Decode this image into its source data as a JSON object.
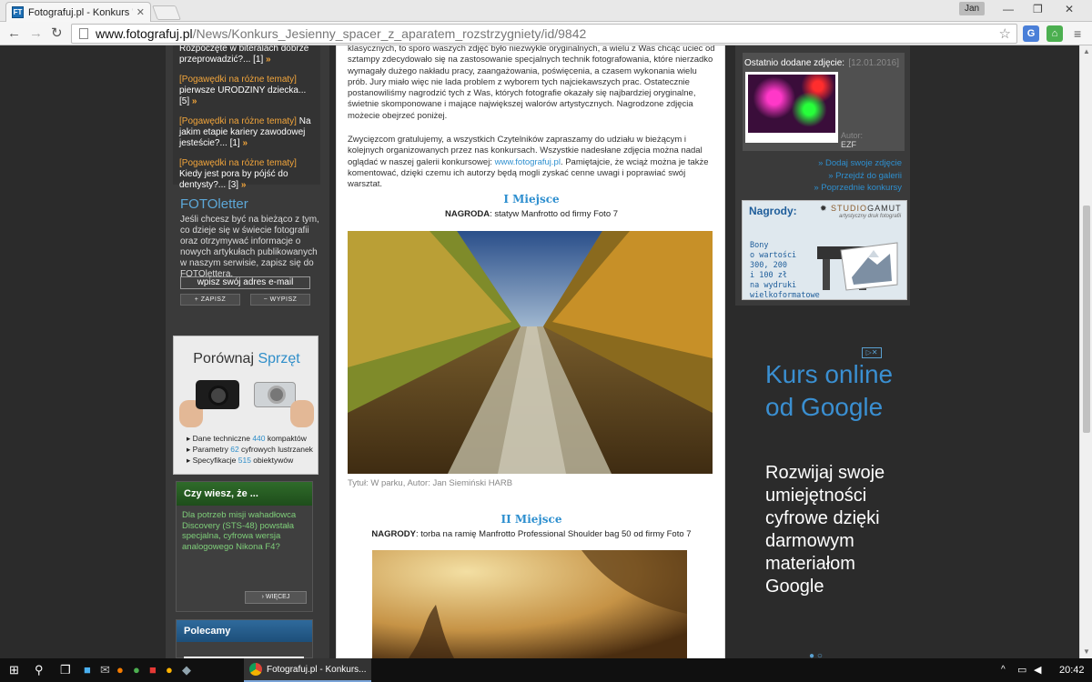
{
  "browser": {
    "tab_title": "Fotografuj.pl - Konkurs \"Je",
    "user": "Jan",
    "url_host": "www.fotografuj.pl",
    "url_path": "/News/Konkurs_Jesienny_spacer_z_aparatem_rozstrzygniety/id/9842"
  },
  "left": {
    "forum": [
      {
        "cat": "",
        "text": "Rozpoczęte w biteralach dobrze przeprowadzić?... [1]",
        "more": "»"
      },
      {
        "cat": "[Pogawędki na różne tematy]",
        "text": "pierwsze URODZINY dziecka... [5]",
        "more": "»"
      },
      {
        "cat": "[Pogawędki na różne tematy]",
        "text": "Na jakim etapie kariery zawodowej jesteście?... [1]",
        "more": "»"
      },
      {
        "cat": "[Pogawędki na różne tematy]",
        "text": "Kiedy jest pora by pójść do dentysty?... [3]",
        "more": "»"
      }
    ],
    "fotoletter": {
      "title": "FOTOletter",
      "text": "Jeśli chcesz być na bieżąco z tym, co dzieje się w świecie fotografii oraz otrzymywać informacje o nowych artykułach publikowanych w naszym serwisie, zapisz się do FOTOlettera.",
      "placeholder": "wpisz swój adres e-mail",
      "subscribe": "+ ZAPISZ",
      "unsubscribe": "− WYPISZ"
    },
    "compare": {
      "title_a": "Porównaj",
      "title_b": "Sprzęt",
      "lines": [
        {
          "pre": "Dane techniczne ",
          "num": "440",
          "post": " kompaktów"
        },
        {
          "pre": "Parametry ",
          "num": "62",
          "post": " cyfrowych lustrzanek"
        },
        {
          "pre": "Specyfikacje ",
          "num": "515",
          "post": " obiektywów"
        }
      ]
    },
    "didyou": {
      "title": "Czy wiesz, że ...",
      "text": "Dla potrzeb misji wahadłowca Discovery (STS-48) powstała specjalna, cyfrowa wersja analogowego Nikona F4?",
      "more": "› WIĘCEJ"
    },
    "polecamy": {
      "title": "Polecamy"
    }
  },
  "article": {
    "intro": "klasycznych, to sporo waszych zdjęć było niezwykle oryginalnych, a wielu z Was chcąc uciec od sztampy zdecydowało się na zastosowanie specjalnych technik fotografowania, które nierzadko wymagały dużego nakładu pracy, zaangażowania, poświęcenia, a czasem wykonania wielu prób. Jury miało więc nie lada problem z wyborem tych najciekawszych prac. Ostatecznie postanowiliśmy nagrodzić tych z Was, których fotografie okazały się najbardziej oryginalne, świetnie skomponowane i mające największej walorów artystycznych. Nagrodzone zdjęcia możecie obejrzeć poniżej.",
    "thanks_a": "Zwycięzcom gratulujemy, a wszystkich Czytelników zapraszamy do udziału w bieżącym i kolejnych organizowanych przez nas konkursach. Wszystkie nadesłane zdjęcia można nadal oglądać w naszej galerii konkursowej: ",
    "thanks_link": "www.fotografuj.pl",
    "thanks_b": ". Pamiętajcie, że wciąż można je także komentować, dzięki czemu ich autorzy będą mogli zyskać cenne uwagi i poprawiać swój warsztat.",
    "place1": "I Miejsce",
    "prize1_label": "NAGRODA",
    "prize1": ": statyw Manfrotto od firmy Foto 7",
    "caption1": "Tytuł: W parku, Autor: Jan Siemiński HARB",
    "place2": "II Miejsce",
    "prize2_label": "NAGRODY",
    "prize2": ": torba na ramię Manfrotto Professional Shoulder bag 50 od firmy Foto 7"
  },
  "right": {
    "recent_label": "Ostatnio dodane zdjęcie:",
    "recent_date": "[12.01.2016]",
    "recent_autor": "Autor:",
    "recent_name": "EZF",
    "links": [
      "» Dodaj swoje zdjęcie",
      "» Przejdź do galerii",
      "» Poprzednie konkursy"
    ],
    "nagrody": {
      "title": "Nagrody:",
      "logo_a": "STUDIO",
      "logo_b": "GAMUT",
      "sub": "artystyczny druk fotografii",
      "lines": [
        "Bony",
        "o wartości",
        "300, 200",
        "i 100 zł",
        "na wydruki",
        "wielkoformatowe"
      ]
    }
  },
  "ad": {
    "badge": "▷✕",
    "headline": "Kurs online od Google",
    "body": "Rozwijaj swoje umiejętności cyfrowe dzięki darmowym materiałom Google",
    "dots": "● ○"
  },
  "taskbar": {
    "app_label": "Fotografuj.pl - Konkurs...",
    "time": "20:42"
  }
}
